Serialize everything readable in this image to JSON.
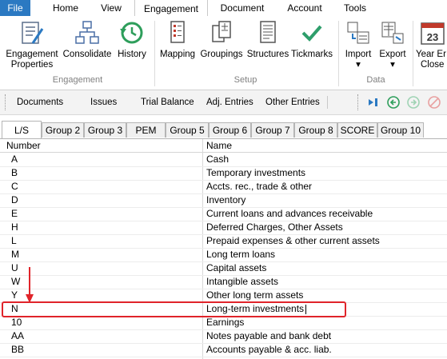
{
  "menu": {
    "items": [
      "File",
      "Home",
      "View",
      "Engagement",
      "Document",
      "Account",
      "Tools"
    ],
    "active": "Engagement"
  },
  "ribbon": {
    "engagement_group": {
      "label": "Engagement",
      "buttons": [
        {
          "label1": "Engagement",
          "label2": "Properties",
          "icon": "engagement-properties-icon"
        },
        {
          "label1": "Consolidate",
          "label2": "",
          "icon": "consolidate-icon"
        },
        {
          "label1": "History",
          "label2": "",
          "icon": "history-icon"
        }
      ]
    },
    "setup_group": {
      "label": "Setup",
      "buttons": [
        {
          "label1": "Mapping",
          "icon": "mapping-icon"
        },
        {
          "label1": "Groupings",
          "icon": "groupings-icon"
        },
        {
          "label1": "Structures",
          "icon": "structures-icon"
        },
        {
          "label1": "Tickmarks",
          "icon": "tickmark-icon"
        }
      ]
    },
    "data_group": {
      "label": "Data",
      "buttons": [
        {
          "label1": "Import",
          "icon": "import-icon",
          "dropdown": "▾"
        },
        {
          "label1": "Export",
          "icon": "export-icon",
          "dropdown": "▾"
        }
      ]
    },
    "year_end": {
      "label1": "Year Er",
      "label2": "Close",
      "icon": "calendar-icon",
      "icon_text": "23"
    }
  },
  "toolbar": {
    "items": [
      "Documents",
      "Issues",
      "Trial Balance",
      "Adj. Entries",
      "Other Entries"
    ]
  },
  "tabs": [
    "L/S",
    "Group 2",
    "Group 3",
    "PEM",
    "Group 5",
    "Group 6",
    "Group 7",
    "Group 8",
    "SCORE",
    "Group 10"
  ],
  "active_tab": "L/S",
  "grid": {
    "columns": [
      "Number",
      "Name"
    ],
    "rows": [
      {
        "number": "A",
        "name": "Cash"
      },
      {
        "number": "B",
        "name": "Temporary investments"
      },
      {
        "number": "C",
        "name": "Accts. rec., trade & other"
      },
      {
        "number": "D",
        "name": "Inventory"
      },
      {
        "number": "E",
        "name": "Current loans and advances receivable"
      },
      {
        "number": "H",
        "name": "Deferred Charges, Other Assets"
      },
      {
        "number": "L",
        "name": "Prepaid expenses & other current assets"
      },
      {
        "number": "M",
        "name": "Long term loans"
      },
      {
        "number": "U",
        "name": "Capital assets"
      },
      {
        "number": "W",
        "name": "Intangible assets"
      },
      {
        "number": "Y",
        "name": "Other long term assets"
      },
      {
        "number": "N",
        "name": "Long-term investments"
      },
      {
        "number": "10",
        "name": "Earnings"
      },
      {
        "number": "AA",
        "name": "Notes payable and bank debt"
      },
      {
        "number": "BB",
        "name": "Accounts payable & acc. liab."
      }
    ]
  },
  "colors": {
    "file_menu": "#2b79c2",
    "highlight": "#e0242a",
    "accent": "#2b79c2"
  }
}
